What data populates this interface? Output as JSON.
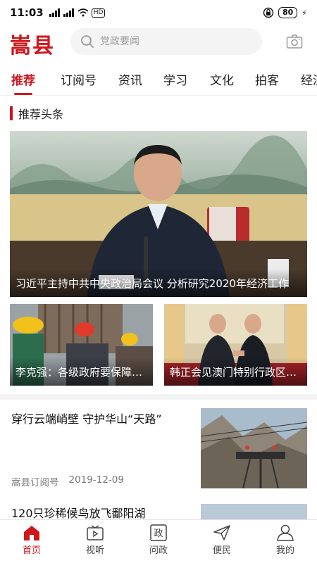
{
  "status_bar": {
    "time": "11:03",
    "signal_1": "4G",
    "signal_2": "4G",
    "hd": "HD",
    "battery": "80"
  },
  "header": {
    "logo": "嵩县",
    "search_placeholder": "党政要闻"
  },
  "tabs": [
    "推荐",
    "订阅号",
    "资讯",
    "学习",
    "文化",
    "拍客",
    "经济"
  ],
  "active_tab_index": 0,
  "section_title": "推荐头条",
  "headline": {
    "caption": "习近平主持中共中央政治局会议 分析研究2020年经济工作"
  },
  "sub_cards": [
    {
      "caption": "李克强：各级政府要保障农民工工资"
    },
    {
      "caption": "韩正会见澳门特别行政区行政长官"
    }
  ],
  "articles": [
    {
      "title": "穿行云端峭壁 守护华山“天路”",
      "source": "嵩县订阅号",
      "date": "2019-12-09"
    },
    {
      "title": "120只珍稀候鸟放飞鄱阳湖"
    }
  ],
  "bottom_nav": [
    {
      "label": "首页",
      "icon": "home-icon"
    },
    {
      "label": "视听",
      "icon": "tv-play-icon"
    },
    {
      "label": "问政",
      "icon": "zheng-icon"
    },
    {
      "label": "便民",
      "icon": "send-icon"
    },
    {
      "label": "我的",
      "icon": "user-icon"
    }
  ],
  "colors": {
    "brand_red": "#d0161d"
  }
}
